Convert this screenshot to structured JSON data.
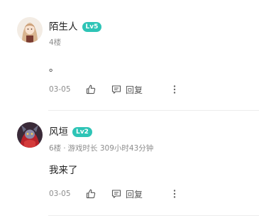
{
  "comments": [
    {
      "username": "陌生人",
      "level": "Lv5",
      "floor": "4楼",
      "playtime": "",
      "content": "。",
      "date": "03-05",
      "reply_label": "回复"
    },
    {
      "username": "风垣",
      "level": "Lv2",
      "floor": "6楼",
      "playtime": "游戏时长 309小时43分钟",
      "content": "我来了",
      "date": "03-05",
      "reply_label": "回复"
    }
  ],
  "icons": {
    "like": "thumbs-up-icon",
    "reply": "comment-bubble-icon",
    "more": "more-vertical-icon"
  },
  "colors": {
    "level_badge": "#2ec4b6",
    "meta_text": "#8c8c8c",
    "divider": "#ececec"
  }
}
